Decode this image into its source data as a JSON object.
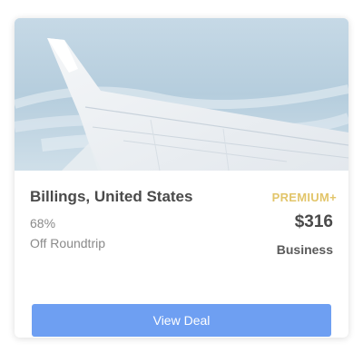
{
  "card": {
    "destination": "Billings, United States",
    "tier": "PREMIUM+",
    "discount_percent": "68%",
    "discount_label": "Off Roundtrip",
    "price": "$316",
    "cabin_class": "Business",
    "cta_label": "View Deal"
  },
  "colors": {
    "tier_gold": "#e2c56a",
    "button_blue": "#6e9ff2",
    "text_dark": "#4a4a4a",
    "text_muted": "#8a8a8a"
  }
}
